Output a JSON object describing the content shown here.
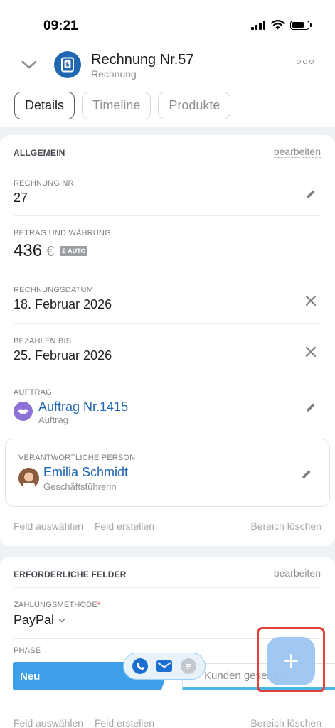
{
  "status_bar": {
    "time": "09:21"
  },
  "header": {
    "title": "Rechnung Nr.57",
    "subtitle": "Rechnung"
  },
  "tabs": [
    {
      "label": "Details",
      "active": true
    },
    {
      "label": "Timeline",
      "active": false
    },
    {
      "label": "Produkte",
      "active": false
    }
  ],
  "general": {
    "title": "ALLGEMEIN",
    "edit": "bearbeiten",
    "fields": {
      "invoice_no": {
        "label": "RECHNUNG NR.",
        "value": "27"
      },
      "amount": {
        "label": "BETRAG UND WÄHRUNG",
        "value": "436",
        "currency": "€",
        "badge": "AUTO"
      },
      "invoice_date": {
        "label": "RECHNUNGSDATUM",
        "value": "18. Februar 2026"
      },
      "due_date": {
        "label": "BEZAHLEN BIS",
        "value": "25. Februar 2026"
      },
      "order": {
        "label": "AUFTRAG",
        "value": "Auftrag Nr.1415",
        "sub": "Auftrag"
      },
      "responsible": {
        "label": "VERANTWORTLICHE PERSON",
        "value": "Emilia Schmidt",
        "sub": "Geschäftsführerin"
      }
    },
    "footer": {
      "select_field": "Feld auswählen",
      "create_field": "Feld erstellen",
      "delete_section": "Bereich löschen"
    }
  },
  "required": {
    "title": "ERFORDERLICHE FELDER",
    "edit": "bearbeiten",
    "payment": {
      "label": "ZAHLUNGSMETHODE",
      "required_mark": "*",
      "value": "PayPal"
    },
    "phase": {
      "label": "PHASE",
      "current": "Neu",
      "next": "Kunden gesendet"
    },
    "footer": {
      "select_field": "Feld auswählen",
      "create_field": "Feld erstellen",
      "delete_section": "Bereich löschen"
    }
  },
  "colors": {
    "accent": "#2066b0",
    "stage_blue": "#3d9fe8",
    "highlight": "#e0413d"
  }
}
